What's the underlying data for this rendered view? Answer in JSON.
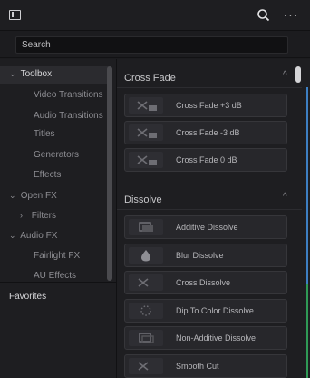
{
  "search": {
    "placeholder": "Search"
  },
  "left": {
    "items": [
      {
        "label": "Toolbox",
        "arrow": "⌄"
      },
      {
        "label": "Video Transitions"
      },
      {
        "label": "Audio Transitions"
      },
      {
        "label": "Titles"
      },
      {
        "label": "Generators"
      },
      {
        "label": "Effects"
      },
      {
        "label": "Open FX",
        "arrow": "⌄"
      },
      {
        "label": "Filters",
        "arrow": "›"
      },
      {
        "label": "Audio FX",
        "arrow": "⌄"
      },
      {
        "label": "Fairlight FX"
      },
      {
        "label": "AU Effects"
      }
    ],
    "favorites": "Favorites"
  },
  "right": {
    "sections": [
      {
        "title": "Cross Fade",
        "chevron": "^"
      },
      {
        "title": "Dissolve",
        "chevron": "^"
      }
    ],
    "crossfade": [
      {
        "label": "Cross Fade +3 dB",
        "icon": "crossfade-plus3-icon",
        "badge": "+3"
      },
      {
        "label": "Cross Fade -3 dB",
        "icon": "crossfade-minus3-icon",
        "badge": "-3"
      },
      {
        "label": "Cross Fade 0 dB",
        "icon": "crossfade-0-icon",
        "badge": "0",
        "flag": true
      }
    ],
    "dissolve": [
      {
        "label": "Additive Dissolve",
        "icon": "additive-dissolve-icon"
      },
      {
        "label": "Blur Dissolve",
        "icon": "blur-drop-icon"
      },
      {
        "label": "Cross Dissolve",
        "icon": "cross-dissolve-icon",
        "flag": true
      },
      {
        "label": "Dip To Color Dissolve",
        "icon": "dip-dots-icon"
      },
      {
        "label": "Non-Additive Dissolve",
        "icon": "non-additive-icon"
      },
      {
        "label": "Smooth Cut",
        "icon": "smooth-cut-icon"
      }
    ]
  },
  "topbar": {
    "more": "···"
  },
  "colors": {
    "accent_blue": "#3d7fc3",
    "accent_green": "#2f9a56",
    "flag_red": "#e8444d"
  }
}
